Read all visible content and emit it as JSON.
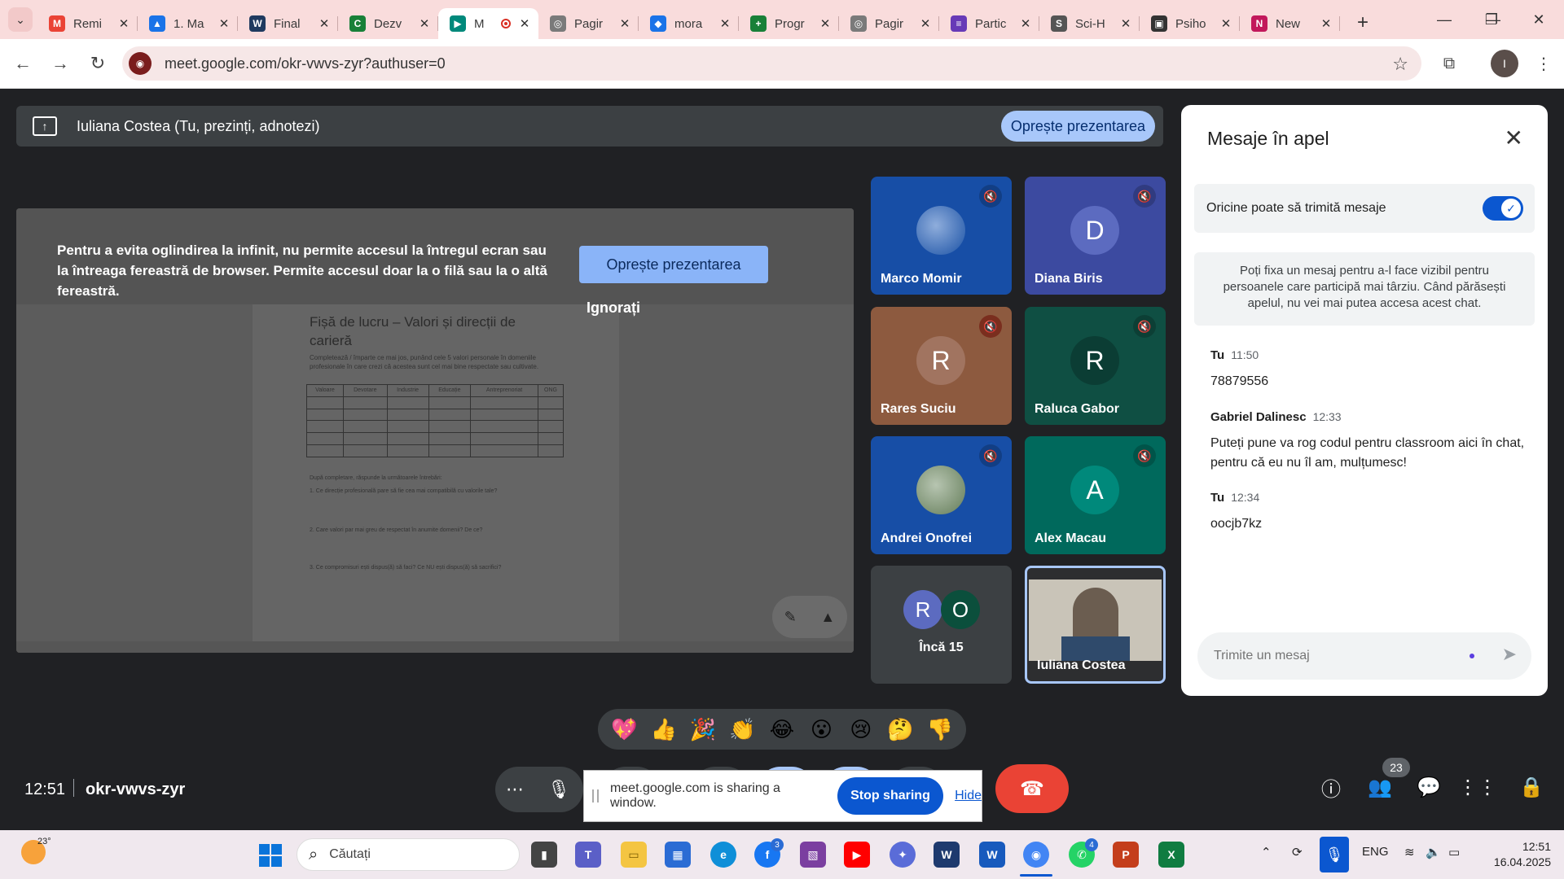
{
  "browser": {
    "tabs": [
      {
        "title": "Remi",
        "icon": "gmail-icon",
        "color": "#ea4335",
        "glyph": "M"
      },
      {
        "title": "1. Ma",
        "icon": "drive-icon",
        "color": "#1a73e8",
        "glyph": "▲"
      },
      {
        "title": "Final",
        "icon": "document-icon",
        "color": "#1f3a5f",
        "glyph": "W"
      },
      {
        "title": "Dezv",
        "icon": "classroom-icon",
        "color": "#188038",
        "glyph": "C"
      },
      {
        "title": "M",
        "icon": "meet-icon",
        "color": "#00897b",
        "glyph": "▶",
        "active": true
      },
      {
        "title": "Pagir",
        "icon": "page-icon",
        "color": "#7a7a7a",
        "glyph": "◎"
      },
      {
        "title": "mora",
        "icon": "diamond-icon",
        "color": "#1a73e8",
        "glyph": "◆"
      },
      {
        "title": "Progr",
        "icon": "sheets-plus-icon",
        "color": "#188038",
        "glyph": "+"
      },
      {
        "title": "Pagir",
        "icon": "page-icon",
        "color": "#7a7a7a",
        "glyph": "◎"
      },
      {
        "title": "Partic",
        "icon": "forms-icon",
        "color": "#673ab7",
        "glyph": "≡"
      },
      {
        "title": "Sci-H",
        "icon": "scihub-icon",
        "color": "#555555",
        "glyph": "S"
      },
      {
        "title": "Psiho",
        "icon": "article-icon",
        "color": "#333333",
        "glyph": "▣"
      },
      {
        "title": "New",
        "icon": "teams-icon",
        "color": "#c2185b",
        "glyph": "N"
      }
    ],
    "url": "meet.google.com/okr-vwvs-zyr?authuser=0"
  },
  "meet": {
    "presenting_banner": "Iuliana Costea (Tu, prezinți, adnotezi)",
    "stop_presenting": "Oprește prezentarea",
    "stage": {
      "warning": "Pentru a evita oglindirea la infinit, nu permite accesul la întregul ecran sau la întreaga fereastră de browser. Permite accesul doar la o filă sau la o altă fereastră.",
      "stop_button": "Oprește prezentarea",
      "ignore_link": "Ignorați",
      "doc_title": "Fișă de lucru – Valori și direcții de carieră",
      "doc_intro": "Completează / împarte ce mai jos, punând cele 5 valori personale în domeniile profesionale în care crezi că acestea sunt cel mai bine respectate sau cultivate.",
      "doc_columns": [
        "Valoare",
        "Devotare",
        "Industrie",
        "Educație",
        "Antreprenoriat",
        "ONG"
      ],
      "doc_after": "După completare, răspunde la următoarele întrebări:",
      "doc_q1": "1. Ce direcție profesională pare să fie cea mai compatibilă cu valorile tale?",
      "doc_q2": "2. Care valori par mai greu de respectat în anumite domenii? De ce?",
      "doc_q3": "3. Ce compromisuri ești dispus(ă) să faci? Ce NU ești dispus(ă) să sacrifici?"
    },
    "participants": [
      {
        "name": "Marco Momir",
        "initial": "",
        "bg": "#174ea6",
        "avatar_bg": "#1e5bb8",
        "muted": true
      },
      {
        "name": "Diana Biris",
        "initial": "D",
        "bg": "#3c4aa0",
        "avatar_bg": "#5c6bc0",
        "muted": true
      },
      {
        "name": "Rares Suciu",
        "initial": "R",
        "bg": "#8d5a3f",
        "avatar_bg": "#a17460",
        "muted": true
      },
      {
        "name": "Raluca Gabor",
        "initial": "R",
        "bg": "#0f4f43",
        "avatar_bg": "#0b3d34",
        "muted": true
      },
      {
        "name": "Andrei Onofrei",
        "initial": "",
        "bg": "#174ea6",
        "avatar_bg": "#6e8a62",
        "muted": true
      },
      {
        "name": "Alex Macau",
        "initial": "A",
        "bg": "#00695c",
        "avatar_bg": "#00897b",
        "muted": true
      }
    ],
    "more_tile": {
      "label": "Încă 15",
      "initials": [
        "R",
        "O"
      ]
    },
    "self_tile": {
      "name": "Iuliana Costea"
    },
    "reactions": [
      "💖",
      "👍",
      "🎉",
      "👏",
      "😂",
      "😮",
      "😢",
      "🤔",
      "👎"
    ],
    "clock": "12:51",
    "meeting_code": "okr-vwvs-zyr",
    "share_bar": {
      "text": "meet.google.com is sharing a window.",
      "stop": "Stop sharing",
      "hide": "Hide"
    },
    "people_count": "23"
  },
  "chat": {
    "title": "Mesaje în apel",
    "toggle_label": "Oricine poate să trimită mesaje",
    "toggle_on": true,
    "info": "Poți fixa un mesaj pentru a-l face vizibil pentru persoanele care participă mai târziu. Când părăsești apelul, nu vei mai putea accesa acest chat.",
    "messages": [
      {
        "sender": "Tu",
        "time": "11:50",
        "text": "78879556"
      },
      {
        "sender": "Gabriel Dalinesc",
        "time": "12:33",
        "text": "Puteți pune va rog codul pentru classroom aici în chat, pentru că eu nu îl am, mulțumesc!"
      },
      {
        "sender": "Tu",
        "time": "12:34",
        "text": "oocjb7kz"
      }
    ],
    "input_placeholder": "Trimite un mesaj"
  },
  "taskbar": {
    "temperature": "23°",
    "search_placeholder": "Căutați",
    "language": "ENG",
    "time": "12:51",
    "date": "16.04.2025",
    "badges": {
      "facebook": "3",
      "whatsapp": "4"
    }
  }
}
